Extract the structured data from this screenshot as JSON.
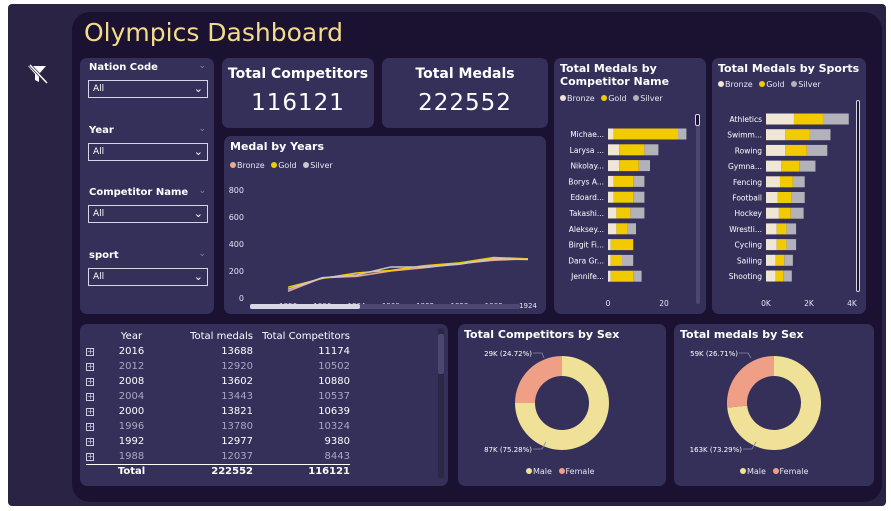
{
  "title": "Olympics Dashboard",
  "colors": {
    "bronze": "#f0e6d6",
    "gold": "#f2ca00",
    "silver": "#b3b1b9",
    "male": "#f0e199",
    "female": "#ee9f85",
    "line_bronze": "#e9a98e",
    "line_gold": "#f2ca00",
    "line_silver": "#c9c7d2",
    "background": "#1b1130",
    "panel": "#34305a",
    "title": "#f2dc8a"
  },
  "slicers": [
    {
      "label": "Nation Code",
      "value": "All"
    },
    {
      "label": "Year",
      "value": "All"
    },
    {
      "label": "Competitor Name",
      "value": "All"
    },
    {
      "label": "sport",
      "value": "All"
    }
  ],
  "kpis": {
    "competitors": {
      "label": "Total Competitors",
      "value": "116121"
    },
    "medals": {
      "label": "Total Medals",
      "value": "222552"
    }
  },
  "table": {
    "headers": [
      "Year",
      "Total medals",
      "Total Competitors"
    ],
    "rows": [
      {
        "year": "2016",
        "medals": "13688",
        "competitors": "11174"
      },
      {
        "year": "2012",
        "medals": "12920",
        "competitors": "10502"
      },
      {
        "year": "2008",
        "medals": "13602",
        "competitors": "10880"
      },
      {
        "year": "2004",
        "medals": "13443",
        "competitors": "10537"
      },
      {
        "year": "2000",
        "medals": "13821",
        "competitors": "10639"
      },
      {
        "year": "1996",
        "medals": "13780",
        "competitors": "10324"
      },
      {
        "year": "1992",
        "medals": "12977",
        "competitors": "9380"
      },
      {
        "year": "1988",
        "medals": "12037",
        "competitors": "8443"
      }
    ],
    "total": {
      "label": "Total",
      "medals": "222552",
      "competitors": "116121"
    }
  },
  "chart_data": [
    {
      "type": "line",
      "title": "Medal by Years",
      "legend_position": "top-left",
      "x": [
        "1896",
        "1906",
        "1904",
        "1900",
        "1932",
        "1928",
        "1908",
        "1924"
      ],
      "ylim": [
        0,
        800
      ],
      "yticks": [
        0,
        200,
        400,
        600,
        800
      ],
      "grid": false,
      "series": [
        {
          "name": "Bronze",
          "values": [
            50,
            150,
            160,
            200,
            225,
            255,
            280,
            290
          ]
        },
        {
          "name": "Gold",
          "values": [
            80,
            145,
            185,
            205,
            240,
            260,
            300,
            290
          ]
        },
        {
          "name": "Silver",
          "values": [
            65,
            150,
            170,
            230,
            230,
            250,
            290,
            285
          ]
        }
      ]
    },
    {
      "type": "bar",
      "orientation": "horizontal",
      "stacked": true,
      "title": "Total Medals by Competitor Name",
      "legend_position": "top-left",
      "categories": [
        "Michae...",
        "Larysa ...",
        "Nikolay...",
        "Borys A...",
        "Edoard...",
        "Takashi...",
        "Aleksey...",
        "Birgit Fi...",
        "Dara Gr...",
        "Jennife..."
      ],
      "xticks": [
        "0",
        "20"
      ],
      "xlim": [
        0,
        30
      ],
      "series": [
        {
          "name": "Bronze",
          "values": [
            2,
            4,
            4,
            2,
            2,
            3,
            3,
            1,
            1,
            1
          ]
        },
        {
          "name": "Gold",
          "values": [
            23,
            9,
            7,
            7,
            7,
            5,
            4,
            8,
            4,
            8
          ]
        },
        {
          "name": "Silver",
          "values": [
            3,
            5,
            4,
            4,
            4,
            5,
            3,
            0,
            4,
            3
          ]
        }
      ]
    },
    {
      "type": "bar",
      "orientation": "horizontal",
      "stacked": true,
      "title": "Total Medals by Sports",
      "legend_position": "top-left",
      "categories": [
        "Athletics",
        "Swimm...",
        "Rowing",
        "Gymna...",
        "Fencing",
        "Football",
        "Hockey",
        "Wrestli...",
        "Cycling",
        "Sailing",
        "Shooting"
      ],
      "xticks": [
        "0K",
        "2K",
        "4K"
      ],
      "xlim": [
        0,
        4000
      ],
      "series": [
        {
          "name": "Bronze",
          "values": [
            1300,
            900,
            900,
            700,
            650,
            550,
            600,
            500,
            500,
            450,
            450
          ]
        },
        {
          "name": "Gold",
          "values": [
            1350,
            1100,
            1000,
            850,
            600,
            650,
            550,
            450,
            450,
            400,
            350
          ]
        },
        {
          "name": "Silver",
          "values": [
            1200,
            1000,
            950,
            750,
            550,
            600,
            600,
            450,
            450,
            400,
            400
          ]
        }
      ]
    },
    {
      "type": "pie",
      "donut": true,
      "title": "Total Competitors by Sex",
      "categories": [
        "Male",
        "Female"
      ],
      "values": [
        87,
        29
      ],
      "labels": [
        "87K (75.28%)",
        "29K (24.72%)"
      ],
      "legend_position": "bottom"
    },
    {
      "type": "pie",
      "donut": true,
      "title": "Total medals by Sex",
      "categories": [
        "Male",
        "Female"
      ],
      "values": [
        163,
        59
      ],
      "labels": [
        "163K (73.29%)",
        "59K (26.71%)"
      ],
      "legend_position": "bottom"
    }
  ]
}
